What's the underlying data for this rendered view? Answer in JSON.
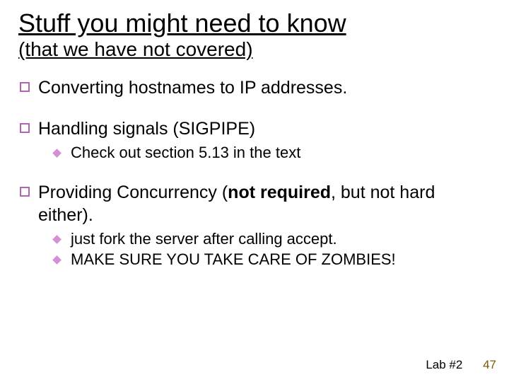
{
  "title": "Stuff you might need to know",
  "subtitle": "(that we have not covered)",
  "bullets": {
    "b0": {
      "text": "Converting hostnames to IP addresses."
    },
    "b1": {
      "text": "Handling signals (SIGPIPE)",
      "sub": {
        "s0": "Check out section 5.13 in the text"
      }
    },
    "b2": {
      "pre": "Providing Concurrency (",
      "strong": "not required",
      "post": ", but not hard either).",
      "sub": {
        "s0": "just fork the server after calling accept.",
        "s1": "MAKE SURE YOU TAKE CARE OF ZOMBIES!"
      }
    }
  },
  "footer": {
    "label": "Lab #2",
    "page": "47"
  }
}
